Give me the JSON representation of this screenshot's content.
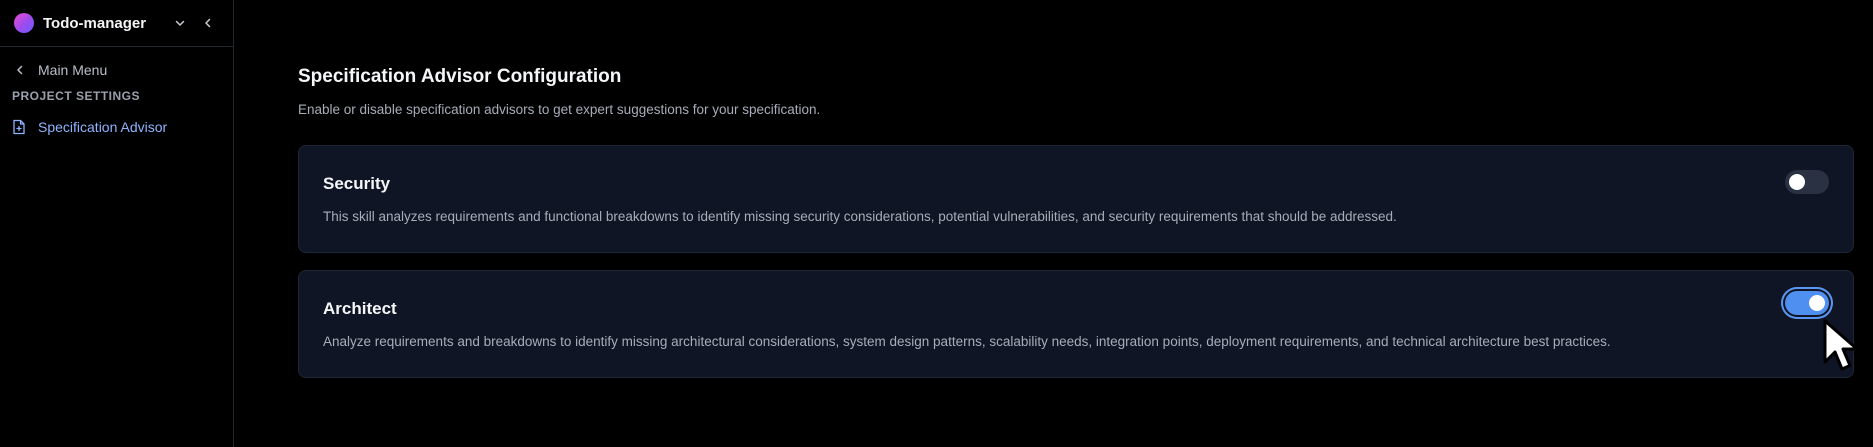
{
  "sidebar": {
    "project_name": "Todo-manager",
    "back_label": "Main Menu",
    "section_heading": "PROJECT SETTINGS",
    "items": [
      {
        "label": "Specification Advisor",
        "icon": "document-icon",
        "active": true
      }
    ]
  },
  "main": {
    "title": "Specification Advisor Configuration",
    "subtitle": "Enable or disable specification advisors to get expert suggestions for your specification.",
    "advisors": [
      {
        "title": "Security",
        "description": "This skill analyzes requirements and functional breakdowns to identify missing security considerations, potential vulnerabilities, and security requirements that should be addressed.",
        "enabled": false
      },
      {
        "title": "Architect",
        "description": "Analyze requirements and breakdowns to identify missing architectural considerations, system design patterns, scalability needs, integration points, deployment requirements, and technical architecture best practices.",
        "enabled": true
      }
    ]
  },
  "colors": {
    "background": "#000000",
    "card_background": "#0f1524",
    "accent": "#4f8ff0",
    "active_nav": "#8fb4ff"
  }
}
